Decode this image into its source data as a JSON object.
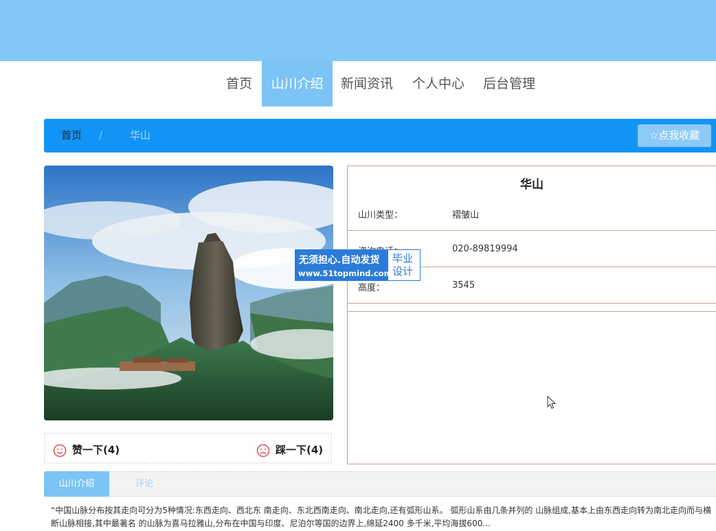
{
  "nav": {
    "items": [
      {
        "label": "首页"
      },
      {
        "label": "山川介绍"
      },
      {
        "label": "新闻资讯"
      },
      {
        "label": "个人中心"
      },
      {
        "label": "后台管理"
      }
    ],
    "active_index": 1
  },
  "breadcrumb": {
    "home": "首页",
    "separator": "/",
    "current": "华山"
  },
  "favorite_button": {
    "icon": "star-outline-icon",
    "label": "☆点我收藏"
  },
  "photo": {
    "description": "mountain-peak-photo"
  },
  "votes": {
    "like": {
      "icon": "smile-icon",
      "label": "赞一下(4)"
    },
    "dislike": {
      "icon": "frown-icon",
      "label": "踩一下(4)"
    }
  },
  "detail": {
    "title": "华山",
    "fields": [
      {
        "label": "山川类型：",
        "value": "褶皱山"
      },
      {
        "label": "咨询电话：",
        "value": "020-89819994"
      },
      {
        "label": "高度：",
        "value": "3545"
      }
    ]
  },
  "watermark": {
    "line1": "无须担心.自动发货",
    "line2": "www.51topmind.com",
    "side1": "毕业",
    "side2": "设计"
  },
  "tabs": [
    {
      "label": "山川介绍"
    },
    {
      "label": "评论"
    }
  ],
  "description": "“中国山脉分布按其走向可分为5种情况:东西走向、西北东 南走向、东北西南走向、南北走向,还有弧形山系。 弧形山系由几条并列的 山脉组成,基本上由东西走向转为南北走向而与横断山脉相接,其中最著名 的山脉为喜马拉雅山,分布在中国与印度、尼泊尔等国的边界上,绵延2400 多千米,平均海拔600...",
  "colors": {
    "banner": "#83c7f8",
    "nav_active": "#7cc4f5",
    "breadcrumb_bar": "#1194f5",
    "favorite_button": "#8ccaf7",
    "info_border": "#c9a28e",
    "vote_icon": "#e34b4b",
    "watermark": "#2b7bd8"
  }
}
